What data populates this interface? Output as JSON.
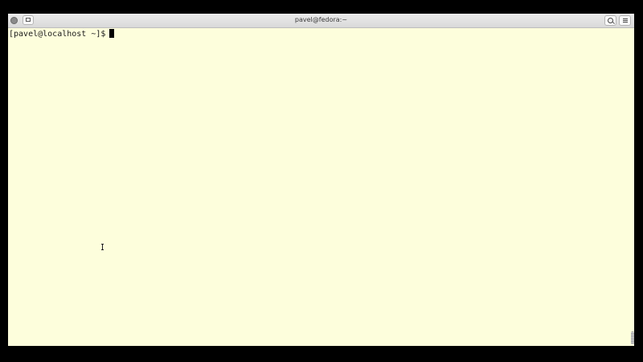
{
  "window": {
    "title": "pavel@fedora:~"
  },
  "terminal": {
    "prompt": "[pavel@localhost ~]$"
  },
  "icons": {
    "close": "close-icon",
    "new_tab": "new-tab-icon",
    "search": "search-icon",
    "menu": "hamburger-menu-icon"
  },
  "colors": {
    "terminal_background": "#fdfedc",
    "terminal_foreground": "#1a1a1a",
    "titlebar": "#e2e2e2"
  }
}
